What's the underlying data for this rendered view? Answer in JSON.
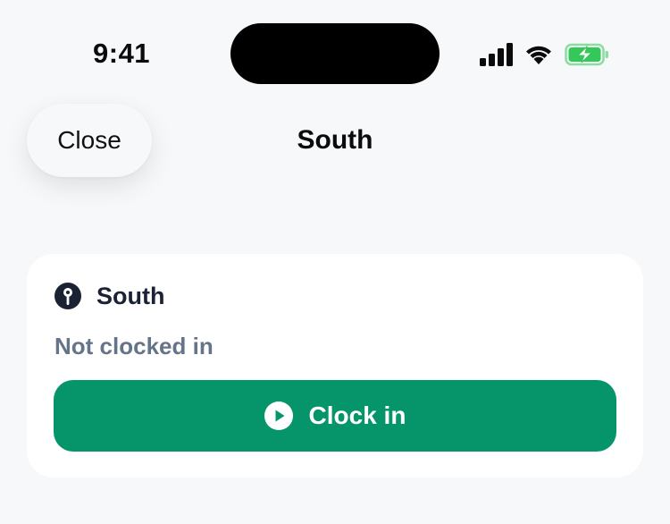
{
  "status_bar": {
    "time": "9:41",
    "icons": [
      "cellular-signal-icon",
      "wifi-icon",
      "battery-charging-icon"
    ],
    "battery_color": "#34c759"
  },
  "header": {
    "close_label": "Close",
    "title": "South"
  },
  "card": {
    "location_icon": "location-pin-icon",
    "title": "South",
    "status": "Not clocked in",
    "clock_in_label": "Clock in",
    "clock_in_icon": "play-circle-icon",
    "accent_color": "#06956a"
  }
}
